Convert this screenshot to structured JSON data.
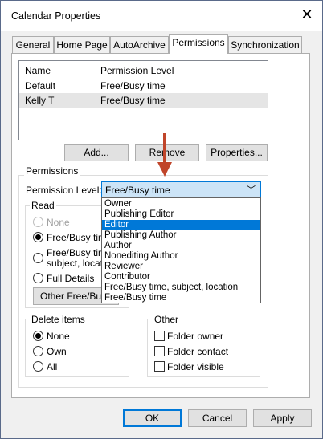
{
  "window": {
    "title": "Calendar Properties"
  },
  "tabs": [
    {
      "label": "General"
    },
    {
      "label": "Home Page"
    },
    {
      "label": "AutoArchive"
    },
    {
      "label": "Permissions"
    },
    {
      "label": "Synchronization"
    }
  ],
  "active_tab": "Permissions",
  "users_list": {
    "headers": [
      "Name",
      "Permission Level"
    ],
    "rows": [
      {
        "name": "Default",
        "level": "Free/Busy time",
        "selected": false
      },
      {
        "name": "Kelly T",
        "level": "Free/Busy time",
        "selected": true
      }
    ]
  },
  "list_buttons": {
    "add": "Add...",
    "remove": "Remove",
    "properties": "Properties..."
  },
  "permissions": {
    "group_label": "Permissions",
    "level_label": "Permission Level:",
    "level_value": "Free/Busy time",
    "dropdown_options": [
      "Owner",
      "Publishing Editor",
      "Editor",
      "Publishing Author",
      "Author",
      "Nonediting Author",
      "Reviewer",
      "Contributor",
      "Free/Busy time, subject, location",
      "Free/Busy time"
    ],
    "highlighted_option": "Editor"
  },
  "read_group": {
    "label": "Read",
    "options": [
      "None",
      "Free/Busy time",
      "Free/Busy time, subject, location",
      "Full Details"
    ],
    "option_visible": [
      "None",
      "Free/Busy tim",
      "Free/Busy tim",
      "subject, locatio",
      "Full Details"
    ],
    "selected": "Free/Busy time",
    "other_button": "Other Free/Busy..."
  },
  "delete_group": {
    "label": "Delete items",
    "options": [
      "None",
      "Own",
      "All"
    ],
    "selected": "None"
  },
  "other_group": {
    "label": "Other",
    "checkboxes": [
      "Folder owner",
      "Folder contact",
      "Folder visible"
    ]
  },
  "footer_buttons": {
    "ok": "OK",
    "cancel": "Cancel",
    "apply": "Apply"
  },
  "colors": {
    "accent": "#0078d7",
    "arrow": "#c0452a",
    "selection": "#cce4f7"
  }
}
